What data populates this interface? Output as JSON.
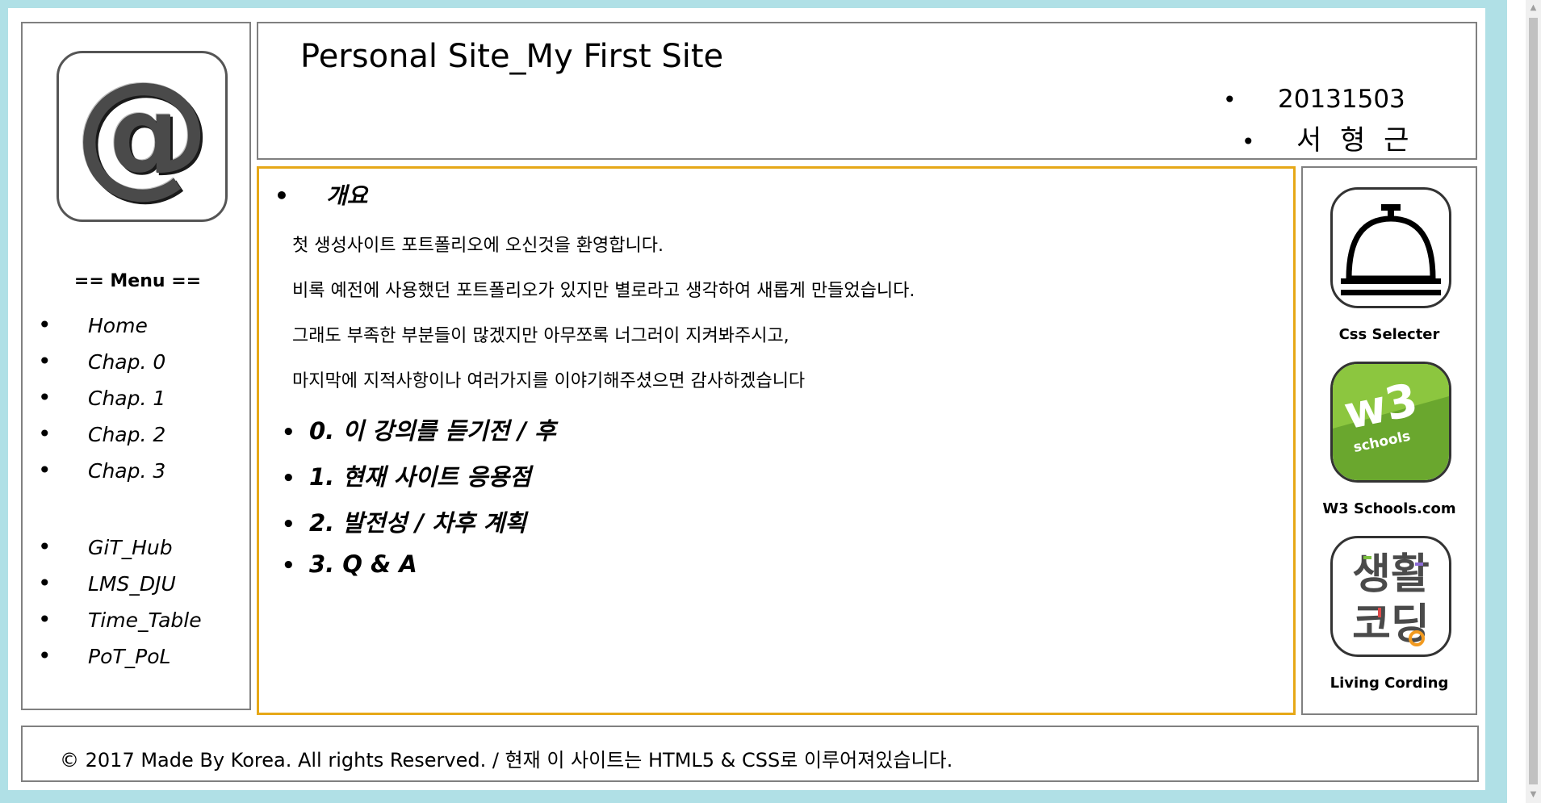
{
  "header": {
    "site_title": "Personal Site_My First Site",
    "info": [
      "20131503",
      "서 형 근"
    ]
  },
  "logo": {
    "glyph": "@",
    "icon": "at-sign-icon"
  },
  "sidebar": {
    "menu_title": "== Menu ==",
    "items": [
      "Home",
      "Chap. 0",
      "Chap. 1",
      "Chap. 2",
      "Chap. 3"
    ],
    "links": [
      "GiT_Hub",
      "LMS_DJU",
      "Time_Table",
      "PoT_PoL"
    ]
  },
  "main": {
    "heading": "개요",
    "paragraphs": [
      "첫 생성사이트 포트폴리오에 오신것을 환영합니다.",
      "비록 예전에 사용했던 포트폴리오가 있지만 별로라고 생각하여 새롭게 만들었습니다.",
      "그래도 부족한 부분들이 많겠지만 아무쪼록 너그러이 지켜봐주시고,",
      "마지막에 지적사항이나 여러가지를 이야기해주셨으면 감사하겠습니다"
    ],
    "sections": [
      "0. 이 강의를 듣기전 / 후",
      "1. 현재 사이트 응용점",
      "2. 발전성 / 차후 계획",
      "3. Q & A"
    ]
  },
  "rightbar": {
    "links": [
      {
        "label": "Css Selecter",
        "icon": "service-bell-icon"
      },
      {
        "label": "W3 Schools.com",
        "icon": "w3schools-logo-icon",
        "logo_text": "w3",
        "logo_sub": "schools"
      },
      {
        "label": "Living Cording",
        "icon": "living-coding-logo-icon",
        "logo_top": "생활",
        "logo_bottom": "코딩"
      }
    ]
  },
  "footer": {
    "text": "© 2017 Made By Korea. All rights Reserved. / 현재 이 사이트는 HTML5 & CSS로 이루어져있습니다."
  },
  "colors": {
    "frame": "#b0e0e6",
    "main_border": "#e6a817",
    "box_border": "#808080",
    "w3_green": "#6aa72e",
    "living_green": "#7bbf3f",
    "living_purple": "#8c6bd6",
    "living_orange": "#f29a1f"
  }
}
